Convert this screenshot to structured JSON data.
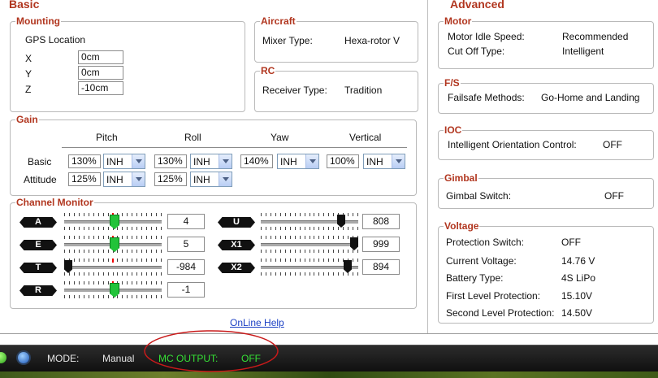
{
  "tabs": {
    "basic": "Basic",
    "advanced": "Advanced"
  },
  "mounting": {
    "title": "Mounting",
    "gps_location": "GPS Location",
    "rows": [
      {
        "label": "X",
        "value": "0cm"
      },
      {
        "label": "Y",
        "value": "0cm"
      },
      {
        "label": "Z",
        "value": "-10cm"
      }
    ]
  },
  "aircraft": {
    "title": "Aircraft",
    "mixer_label": "Mixer Type:",
    "mixer_value": "Hexa-rotor V"
  },
  "rc": {
    "title": "RC",
    "receiver_label": "Receiver Type:",
    "receiver_value": "Tradition"
  },
  "gain": {
    "title": "Gain",
    "columns": [
      "Pitch",
      "Roll",
      "Yaw",
      "Vertical"
    ],
    "basic": {
      "label": "Basic",
      "pitch": "130%",
      "pitch_sel": "INH",
      "roll": "130%",
      "roll_sel": "INH",
      "yaw": "140%",
      "yaw_sel": "INH",
      "vertical": "100%",
      "vertical_sel": "INH"
    },
    "attitude": {
      "label": "Attitude",
      "pitch": "125%",
      "pitch_sel": "INH",
      "roll": "125%",
      "roll_sel": "INH"
    }
  },
  "channel_monitor": {
    "title": "Channel Monitor",
    "channels": [
      {
        "name": "A",
        "value": "4",
        "position": 0.51
      },
      {
        "name": "E",
        "value": "5",
        "position": 0.51
      },
      {
        "name": "T",
        "value": "-984",
        "position": 0.0
      },
      {
        "name": "R",
        "value": "-1",
        "position": 0.51
      },
      {
        "name": "U",
        "value": "808",
        "position": 0.85
      },
      {
        "name": "X1",
        "value": "999",
        "position": 1.0
      },
      {
        "name": "X2",
        "value": "894",
        "position": 0.93
      }
    ]
  },
  "online_help": "OnLine Help",
  "motor": {
    "title": "Motor",
    "idle_label": "Motor Idle Speed:",
    "idle_value": "Recommended",
    "cutoff_label": "Cut Off Type:",
    "cutoff_value": "Intelligent"
  },
  "fs": {
    "title": "F/S",
    "label": "Failsafe Methods:",
    "value": "Go-Home and Landing"
  },
  "ioc": {
    "title": "IOC",
    "label": "Intelligent Orientation Control:",
    "value": "OFF"
  },
  "gimbal": {
    "title": "Gimbal",
    "label": "Gimbal Switch:",
    "value": "OFF"
  },
  "voltage": {
    "title": "Voltage",
    "rows": [
      {
        "label": "Protection Switch:",
        "value": "OFF"
      },
      {
        "label": "Current Voltage:",
        "value": "14.76 V"
      },
      {
        "label": "Battery Type:",
        "value": "4S LiPo"
      },
      {
        "label": "First Level Protection:",
        "value": "15.10V"
      },
      {
        "label": "Second Level Protection:",
        "value": "14.50V"
      }
    ]
  },
  "status_bar": {
    "mode_label": "MODE:",
    "mode_value": "Manual",
    "output_label": "MC OUTPUT:",
    "output_value": "OFF",
    "colors": {
      "output": "#35e035",
      "highlight_ellipse": "#c81a1a"
    }
  }
}
